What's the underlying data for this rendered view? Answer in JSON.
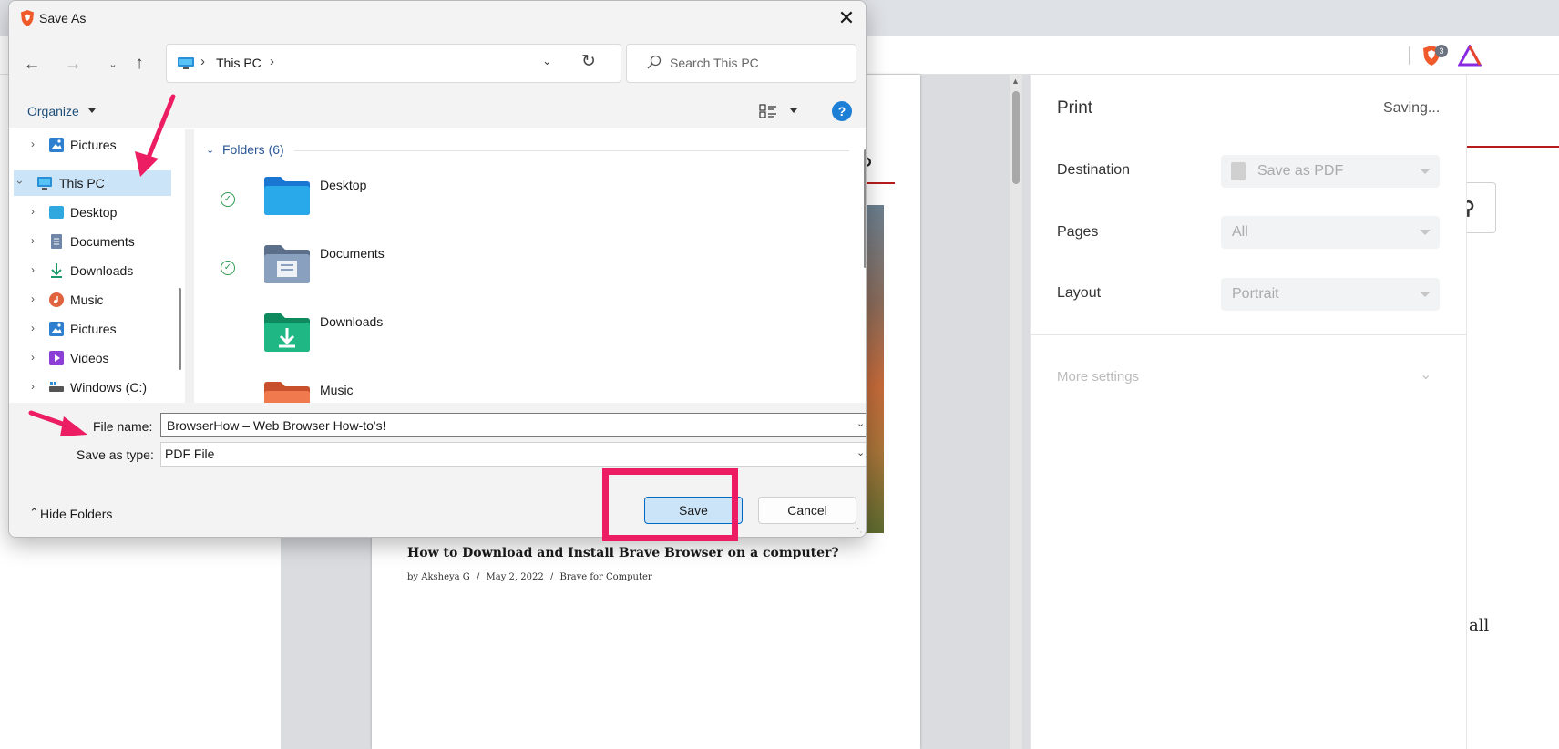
{
  "browser": {
    "shield_count": "3"
  },
  "preview": {
    "article_title": "How to Download and Install Brave Browser on a computer?",
    "meta_author": "by Aksheya G",
    "meta_sep1": "/",
    "meta_date": "May 2, 2022",
    "meta_sep2": "/",
    "meta_category": "Brave for Computer"
  },
  "site": {
    "text_fragment": "all"
  },
  "print_panel": {
    "title": "Print",
    "status": "Saving...",
    "destination_label": "Destination",
    "destination_value": "Save as PDF",
    "pages_label": "Pages",
    "pages_value": "All",
    "layout_label": "Layout",
    "layout_value": "Portrait",
    "more_settings": "More settings"
  },
  "dialog": {
    "title": "Save As",
    "breadcrumb": {
      "location": "This PC",
      "sep": "›"
    },
    "search_placeholder": "Search This PC",
    "organize_label": "Organize",
    "help_label": "?",
    "nav_items": [
      {
        "label": "Pictures",
        "icon": "pictures-icon"
      },
      {
        "label": "This PC",
        "icon": "this-pc-icon",
        "selected": true
      },
      {
        "label": "Desktop",
        "icon": "desktop-icon"
      },
      {
        "label": "Documents",
        "icon": "documents-icon"
      },
      {
        "label": "Downloads",
        "icon": "downloads-icon"
      },
      {
        "label": "Music",
        "icon": "music-icon"
      },
      {
        "label": "Pictures",
        "icon": "pictures-icon"
      },
      {
        "label": "Videos",
        "icon": "videos-icon"
      },
      {
        "label": "Windows (C:)",
        "icon": "drive-icon"
      }
    ],
    "folders_header": "Folders (6)",
    "folders": [
      {
        "label": "Desktop",
        "synced": true
      },
      {
        "label": "Documents",
        "synced": true
      },
      {
        "label": "Downloads",
        "synced": false
      },
      {
        "label": "Music",
        "synced": false
      }
    ],
    "file_name_label": "File name:",
    "file_name_value": "BrowserHow – Web Browser How-to's!",
    "save_type_label": "Save as type:",
    "save_type_value": "PDF File",
    "hide_folders_label": "Hide Folders",
    "save_label": "Save",
    "cancel_label": "Cancel"
  },
  "colors": {
    "annotation_pink": "#ed1d63",
    "selection_blue": "#cce4f7",
    "accent_blue": "#0067c0"
  }
}
